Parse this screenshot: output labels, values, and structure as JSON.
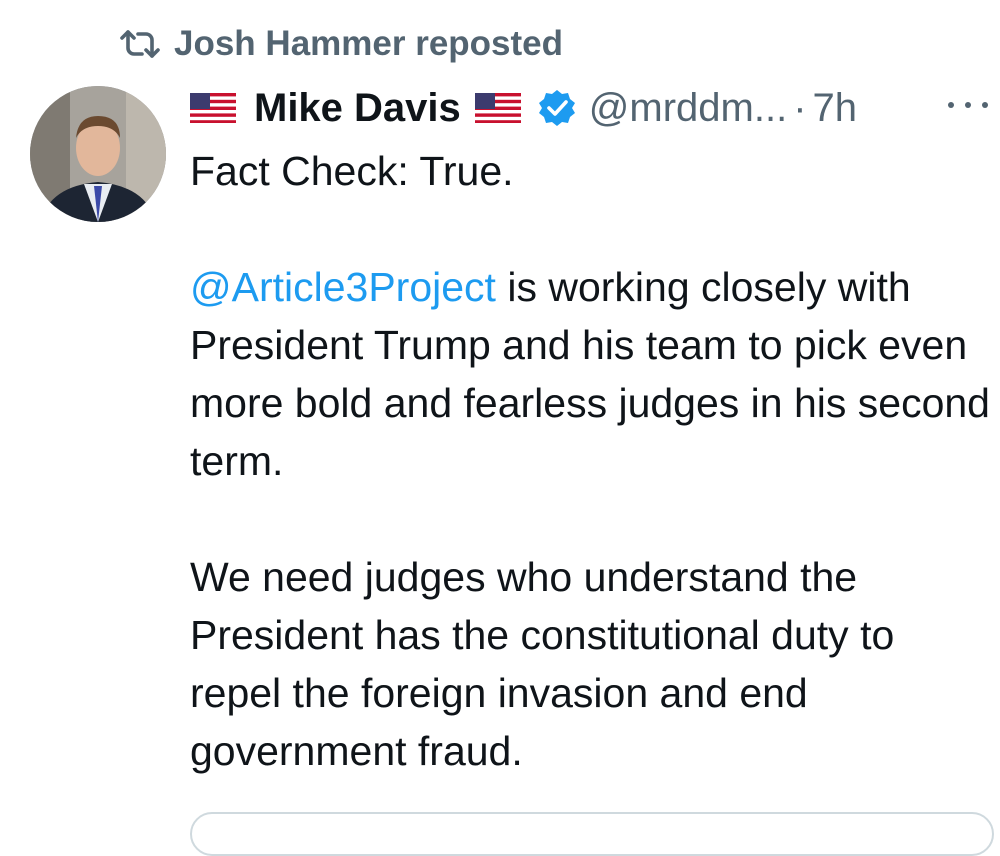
{
  "repost": {
    "icon": "repost-icon",
    "label": "Josh Hammer reposted"
  },
  "author": {
    "avatar_icon": "avatar",
    "flag_before": "us-flag-icon",
    "name": "Mike Davis",
    "flag_after": "us-flag-icon",
    "verified_icon": "verified-badge-icon",
    "handle": "@mrddm...",
    "separator": "·",
    "time": "7h"
  },
  "more_icon": "more-options-icon",
  "tweet": {
    "line1": "Fact Check: True.",
    "mention": "@Article3Project",
    "para2_rest": " is working closely with President Trump and his team to pick even more bold and fearless judges in his second term.",
    "para3": "We need judges who understand the President has the constitutional duty to repel the foreign invasion and end government fraud."
  },
  "colors": {
    "text": "#0f1419",
    "muted": "#536471",
    "accent": "#1d9bf0"
  }
}
